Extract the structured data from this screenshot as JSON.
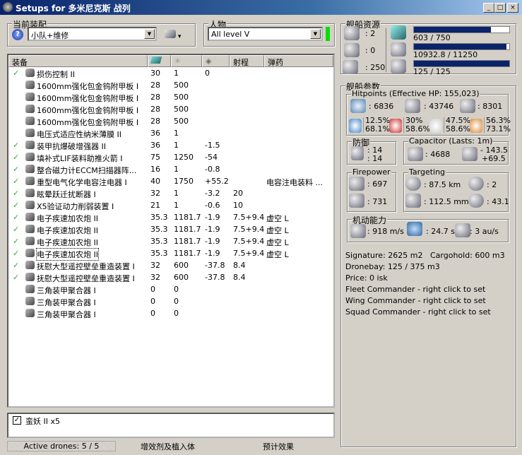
{
  "window": {
    "title": "Setups for 多米尼克斯 战列",
    "controls": [
      "_",
      "□",
      "×"
    ]
  },
  "fitting": {
    "group_label": "当前装配",
    "value": "小队+维修"
  },
  "character": {
    "group_label": "人物",
    "value": "All level V",
    "status_color": "#00e000"
  },
  "table": {
    "headers": [
      "装备",
      "cpu-icon",
      "powergrid-icon",
      "capacitor-icon",
      "射程",
      "弹药"
    ],
    "rows": [
      {
        "checked": true,
        "name": "损伤控制 II",
        "c1": "30",
        "c2": "1",
        "c3": "0",
        "c4": "",
        "c5": ""
      },
      {
        "checked": false,
        "name": "1600mm强化包金钨附甲板 I",
        "c1": "28",
        "c2": "500",
        "c3": "",
        "c4": "",
        "c5": ""
      },
      {
        "checked": false,
        "name": "1600mm强化包金钨附甲板 I",
        "c1": "28",
        "c2": "500",
        "c3": "",
        "c4": "",
        "c5": ""
      },
      {
        "checked": false,
        "name": "1600mm强化包金钨附甲板 I",
        "c1": "28",
        "c2": "500",
        "c3": "",
        "c4": "",
        "c5": ""
      },
      {
        "checked": false,
        "name": "1600mm强化包金钨附甲板 I",
        "c1": "28",
        "c2": "500",
        "c3": "",
        "c4": "",
        "c5": ""
      },
      {
        "checked": false,
        "name": "电压式适应性纳米薄膜 II",
        "c1": "36",
        "c2": "1",
        "c3": "",
        "c4": "",
        "c5": ""
      },
      {
        "checked": true,
        "name": "装甲抗爆破增强器 II",
        "c1": "36",
        "c2": "1",
        "c3": "-1.5",
        "c4": "",
        "c5": ""
      },
      {
        "checked": true,
        "name": "填补式LIF装料助推火箭 I",
        "c1": "75",
        "c2": "1250",
        "c3": "-54",
        "c4": "",
        "c5": ""
      },
      {
        "checked": true,
        "name": "整合磁力计ECCM扫描器阵...",
        "c1": "16",
        "c2": "1",
        "c3": "-0.8",
        "c4": "",
        "c5": ""
      },
      {
        "checked": true,
        "name": "重型电气化学电容注电器 I",
        "c1": "40",
        "c2": "1750",
        "c3": "+55.2",
        "c4": "",
        "c5": "电容注电装料 ..."
      },
      {
        "checked": true,
        "name": "眩晕跃迁扰断器 I",
        "c1": "32",
        "c2": "1",
        "c3": "-3.2",
        "c4": "20",
        "c5": ""
      },
      {
        "checked": true,
        "name": "X5验证动力削弱装置 I",
        "c1": "21",
        "c2": "1",
        "c3": "-0.6",
        "c4": "10",
        "c5": ""
      },
      {
        "checked": true,
        "name": "电子疾速加农炮 II",
        "c1": "35.3",
        "c2": "1181.7",
        "c3": "-1.9",
        "c4": "7.5+9.4",
        "c5": "虚空 L"
      },
      {
        "checked": true,
        "name": "电子疾速加农炮 II",
        "c1": "35.3",
        "c2": "1181.7",
        "c3": "-1.9",
        "c4": "7.5+9.4",
        "c5": "虚空 L"
      },
      {
        "checked": true,
        "name": "电子疾速加农炮 II",
        "c1": "35.3",
        "c2": "1181.7",
        "c3": "-1.9",
        "c4": "7.5+9.4",
        "c5": "虚空 L"
      },
      {
        "checked": true,
        "name": "电子疾速加农炮 II",
        "c1": "35.3",
        "c2": "1181.7",
        "c3": "-1.9",
        "c4": "7.5+9.4",
        "c5": "虚空 L"
      },
      {
        "checked": true,
        "name": "抚慰大型遥控壁垒重造装置 I",
        "c1": "32",
        "c2": "600",
        "c3": "-37.8",
        "c4": "8.4",
        "c5": ""
      },
      {
        "checked": true,
        "name": "抚慰大型遥控壁垒重造装置 I",
        "c1": "32",
        "c2": "600",
        "c3": "-37.8",
        "c4": "8.4",
        "c5": ""
      },
      {
        "checked": false,
        "name": "三角装甲聚合器 I",
        "c1": "0",
        "c2": "0",
        "c3": "",
        "c4": "",
        "c5": ""
      },
      {
        "checked": false,
        "name": "三角装甲聚合器 I",
        "c1": "0",
        "c2": "0",
        "c3": "",
        "c4": "",
        "c5": ""
      },
      {
        "checked": false,
        "name": "三角装甲聚合器 I",
        "c1": "0",
        "c2": "0",
        "c3": "",
        "c4": "",
        "c5": ""
      }
    ]
  },
  "drones": {
    "items": [
      {
        "checked": true,
        "label": "蛮妖 II x5"
      }
    ]
  },
  "bottom_tabs": {
    "active_drones": "Active drones: 5 / 5",
    "boosters": "增效剂及植入体",
    "projected": "预计效果"
  },
  "resources": {
    "label": "舰船资源",
    "turrets": ": 2",
    "launchers": ": 0",
    "drone_bandwidth": ": 250",
    "cpu": {
      "text": "603 / 750",
      "fraction": 0.804
    },
    "powergrid": {
      "text": "10932.8 / 11250",
      "fraction": 0.972
    },
    "calibration": {
      "text": "125 / 125",
      "fraction": 1.0
    }
  },
  "stats": {
    "label": "舰船参数",
    "hitpoints": {
      "label": "Hitpoints (Effective HP: 155,023)",
      "shield": ": 6836",
      "armor": ": 43746",
      "structure": ": 8301",
      "resists": [
        {
          "top": "12.5%",
          "bottom": "68.1%"
        },
        {
          "top": "30%",
          "bottom": "58.6%"
        },
        {
          "top": "47.5%",
          "bottom": "58.6%"
        },
        {
          "top": "56.3%",
          "bottom": "73.1%"
        }
      ]
    },
    "defense": {
      "label": "防御",
      "a": ": 14",
      "b": ": 14"
    },
    "capacitor": {
      "label": "Capacitor (Lasts: 1m)",
      "amount": ": 4688",
      "delta_neg": "- 143.5",
      "delta_pos": "+69.5"
    },
    "firepower": {
      "label": "Firepower",
      "a": ": 697",
      "b": ": 731"
    },
    "targeting": {
      "label": "Targeting",
      "range": ": 87.5 km",
      "targets": ": 2",
      "sensor": ": 112.5 mm",
      "scan": ": 43.1"
    },
    "mobility": {
      "label": "机动能力",
      "speed": ": 918 m/s",
      "align": ": 24.7 s",
      "warp": ": 3 au/s"
    },
    "signature": "Signature: 2625 m2",
    "cargohold": "Cargohold: 600 m3",
    "dronebay": "Dronebay: 125 / 375 m3",
    "price": "Price: 0 isk",
    "fleet": "Fleet Commander - right click to set",
    "wing": "Wing Commander - right click to set",
    "squad": "Squad Commander - right click to set"
  }
}
